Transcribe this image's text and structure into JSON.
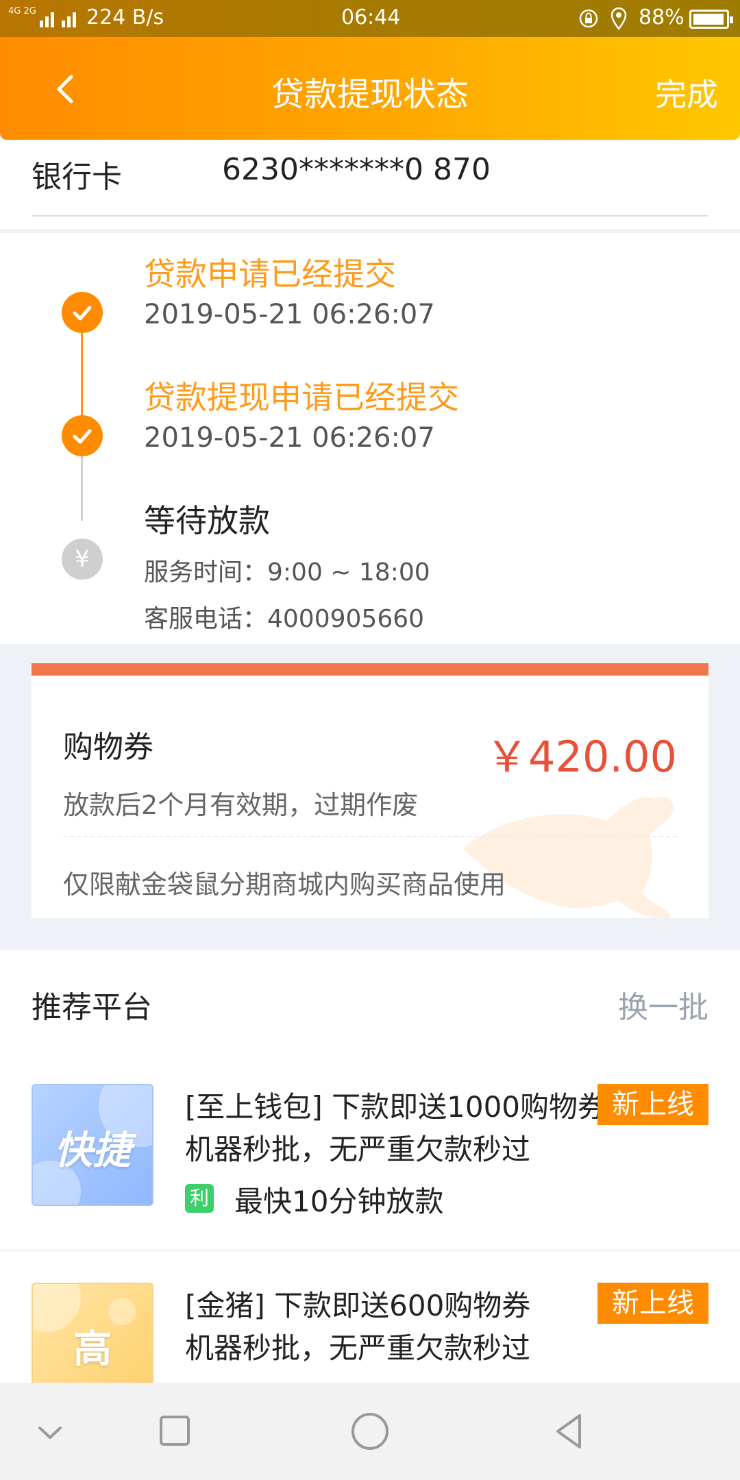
{
  "status_bar": {
    "signal_text": "4G 2G",
    "network_speed": "224 B/s",
    "time": "06:44",
    "battery": "88%"
  },
  "header": {
    "title": "贷款提现状态",
    "done_label": "完成"
  },
  "bank_card": {
    "label": "银行卡",
    "value": "6230*******0 870"
  },
  "timeline": [
    {
      "title": "贷款申请已经提交",
      "time": "2019-05-21 06:26:07",
      "status": "done"
    },
    {
      "title": "贷款提现申请已经提交",
      "time": "2019-05-21 06:26:07",
      "status": "done"
    },
    {
      "title": "等待放款",
      "status": "pending",
      "service_hours": "服务时间：9:00 ~ 18:00",
      "service_phone": "客服电话：4000905660",
      "icon_glyph": "¥"
    }
  ],
  "coupon": {
    "name": "购物券",
    "amount": "￥420.00",
    "validity": "放款后2个月有效期，过期作废",
    "usage": "仅限献金袋鼠分期商城内购买商品使用",
    "accent_color": "#f0774a"
  },
  "recommend": {
    "title": "推荐平台",
    "refresh_label": "换一批",
    "items": [
      {
        "thumb_text": "快捷",
        "line1": "[至上钱包] 下款即送1000购物券",
        "line2": "机器秒批，无严重欠款秒过",
        "tag": "利",
        "feature": "最快10分钟放款",
        "badge": "新上线"
      },
      {
        "thumb_text": "高",
        "line1": "[金猪] 下款即送600购物券",
        "line2": "机器秒批，无严重欠款秒过",
        "badge": "新上线"
      }
    ]
  },
  "colors": {
    "header_start": "#ff8c00",
    "header_end": "#ffc700",
    "timeline_done": "#ff8c00",
    "amount": "#e8503a",
    "badge": "#ff8c00",
    "tag_green": "#3ecf6a"
  }
}
